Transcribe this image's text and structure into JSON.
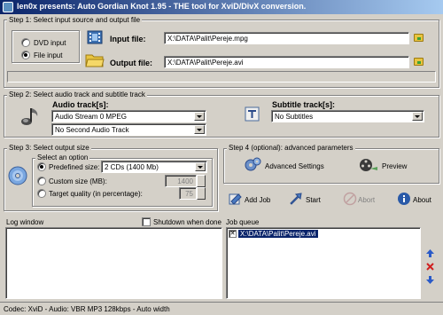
{
  "window": {
    "title": "len0x presents: Auto Gordian Knot 1.95 - THE tool for XviD/DivX conversion."
  },
  "step1": {
    "label": "Step 1: Select input source and output file",
    "dvd_input": "DVD input",
    "file_input": "File input",
    "selected_source": "File input",
    "input_label": "Input file:",
    "input_value": "X:\\DATA\\Palit\\Pereje.mpg",
    "output_label": "Output file:",
    "output_value": "X:\\DATA\\Palit\\Pereje.avi"
  },
  "step2": {
    "label": "Step 2: Select audio track and subtitle track",
    "audio_label": "Audio track[s]:",
    "audio_track_1": "Audio Stream 0 MPEG",
    "audio_track_2": "No Second Audio Track",
    "subtitle_label": "Subtitle track[s]:",
    "subtitle_value": "No Subtitles"
  },
  "step3": {
    "label": "Step 3: Select output size",
    "option_label": "Select an option",
    "predefined_label": "Predefined size:",
    "predefined_value": "2 CDs (1400 Mb)",
    "custom_label": "Custom size (MB):",
    "custom_value": "1400",
    "quality_label": "Target quality (in percentage):",
    "quality_value": "75",
    "selected_option": "Predefined size:"
  },
  "step4": {
    "label": "Step 4 (optional): advanced parameters",
    "advanced_label": "Advanced Settings",
    "preview_label": "Preview"
  },
  "actions": {
    "add_job": "Add Job",
    "start": "Start",
    "abort": "Abort",
    "about": "About"
  },
  "log": {
    "label": "Log window",
    "shutdown_label": "Shutdown when done"
  },
  "queue": {
    "label": "Job queue",
    "items": [
      "X:\\DATA\\Palit\\Pereje.avi"
    ]
  },
  "status": {
    "text": "Codec: XviD -  Audio: VBR MP3 128kbps -  Auto width"
  },
  "colors": {
    "face": "#d4d0c8",
    "title_start": "#0a246a",
    "title_end": "#a6caf0",
    "selection": "#0a246a"
  },
  "icons": [
    "app-icon",
    "film-icon",
    "folder-icon",
    "music-note-icon",
    "text-icon",
    "disc-icon",
    "gears-icon",
    "film-reel-icon",
    "add-job-icon",
    "start-icon",
    "abort-icon",
    "about-icon",
    "up-arrow-icon",
    "delete-icon",
    "down-arrow-icon"
  ]
}
